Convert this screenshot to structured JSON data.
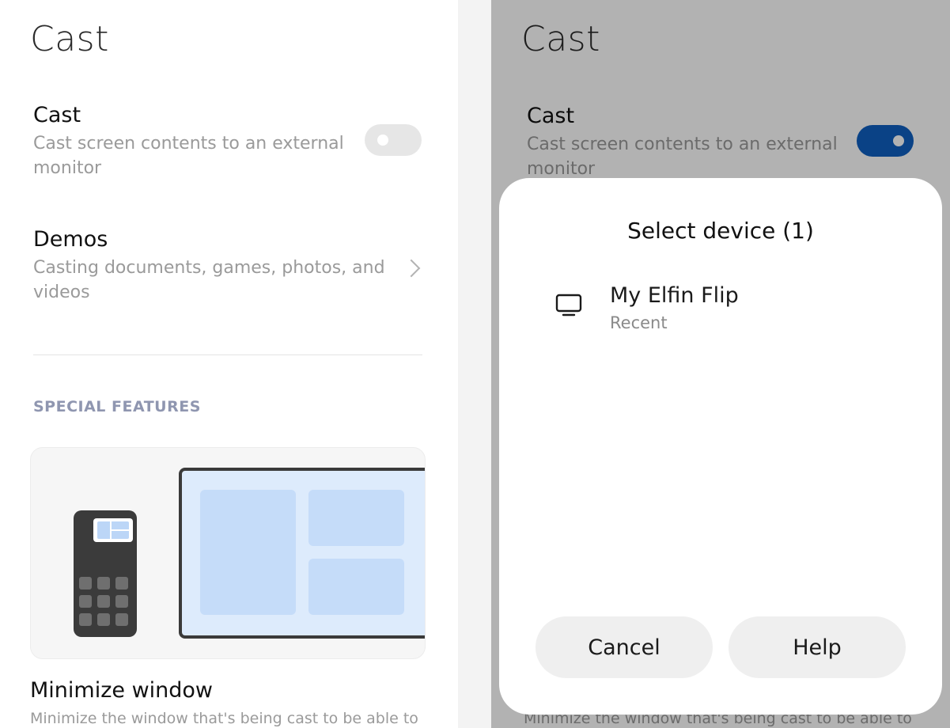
{
  "left": {
    "page_title": "Cast",
    "cast": {
      "title": "Cast",
      "subtitle": "Cast screen contents to an external monitor",
      "toggle_on": false
    },
    "demos": {
      "title": "Demos",
      "subtitle": "Casting documents, games, photos, and videos"
    },
    "section_label": "SPECIAL FEATURES",
    "feature": {
      "title": "Minimize window",
      "subtitle": "Minimize the window that's being cast to be able to"
    }
  },
  "right": {
    "page_title": "Cast",
    "cast": {
      "title": "Cast",
      "subtitle": "Cast screen contents to an external monitor",
      "toggle_on": true
    },
    "feature_subtitle": "Minimize the window that's being cast to be able to",
    "dialog": {
      "title": "Select device (1)",
      "devices": [
        {
          "name": "My Elfin Flip",
          "status": "Recent",
          "icon": "monitor-icon"
        }
      ],
      "cancel_label": "Cancel",
      "help_label": "Help"
    }
  },
  "colors": {
    "accent": "#0f5fc0",
    "section_label": "#8f96b0",
    "secondary_text": "#9a9a9a",
    "illustration_blue": "#cfe2fb"
  }
}
